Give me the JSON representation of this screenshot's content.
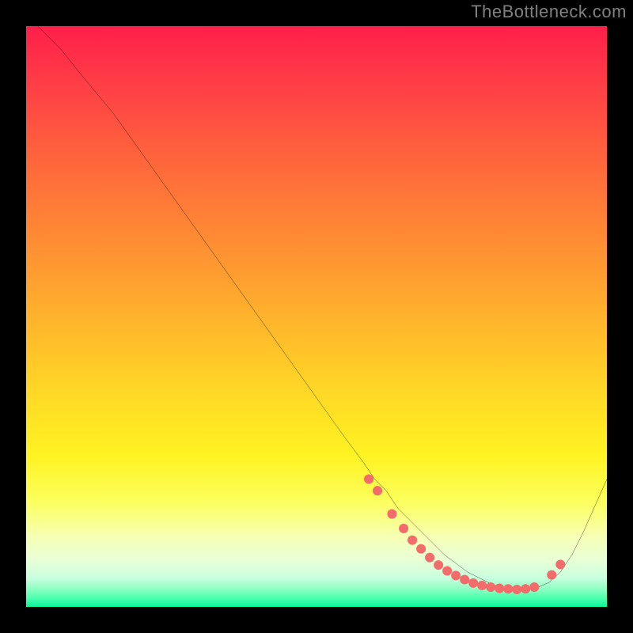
{
  "attribution": "TheBottleneck.com",
  "chart_data": {
    "type": "line",
    "title": "",
    "xlabel": "",
    "ylabel": "",
    "xlim": [
      0,
      100
    ],
    "ylim": [
      0,
      100
    ],
    "series": [
      {
        "name": "curve",
        "x": [
          2,
          6,
          10,
          15,
          20,
          25,
          30,
          35,
          40,
          45,
          50,
          55,
          58,
          60,
          62,
          64,
          66,
          68,
          70,
          72,
          74,
          76,
          78,
          80,
          82,
          84,
          86,
          88,
          90,
          92,
          94,
          96,
          98,
          100
        ],
        "y": [
          100,
          96,
          91,
          85,
          78,
          71,
          64,
          57,
          50,
          43,
          36,
          29,
          25,
          22,
          20,
          17,
          15,
          13,
          11,
          9,
          7.5,
          6,
          5,
          4,
          3.3,
          3,
          3,
          3.3,
          4.2,
          6,
          9,
          13,
          17.5,
          22
        ]
      }
    ],
    "markers": {
      "color": "#f36b6b",
      "radius": 6,
      "points_x": [
        59,
        60.5,
        63,
        65,
        66.5,
        68,
        69.5,
        71,
        72.5,
        74,
        75.5,
        77,
        78.5,
        80,
        81.5,
        83,
        84.5,
        86,
        87.5,
        90.5,
        92
      ],
      "points_y": [
        22,
        20,
        16,
        13.5,
        11.5,
        10,
        8.5,
        7.2,
        6.2,
        5.4,
        4.7,
        4.1,
        3.7,
        3.4,
        3.2,
        3.1,
        3.0,
        3.1,
        3.4,
        5.5,
        7.3
      ]
    },
    "gradient_stops": [
      {
        "pct": 0,
        "color": "#ff1f4a"
      },
      {
        "pct": 50,
        "color": "#ffb22c"
      },
      {
        "pct": 80,
        "color": "#fcff5e"
      },
      {
        "pct": 100,
        "color": "#0cf59c"
      }
    ]
  }
}
